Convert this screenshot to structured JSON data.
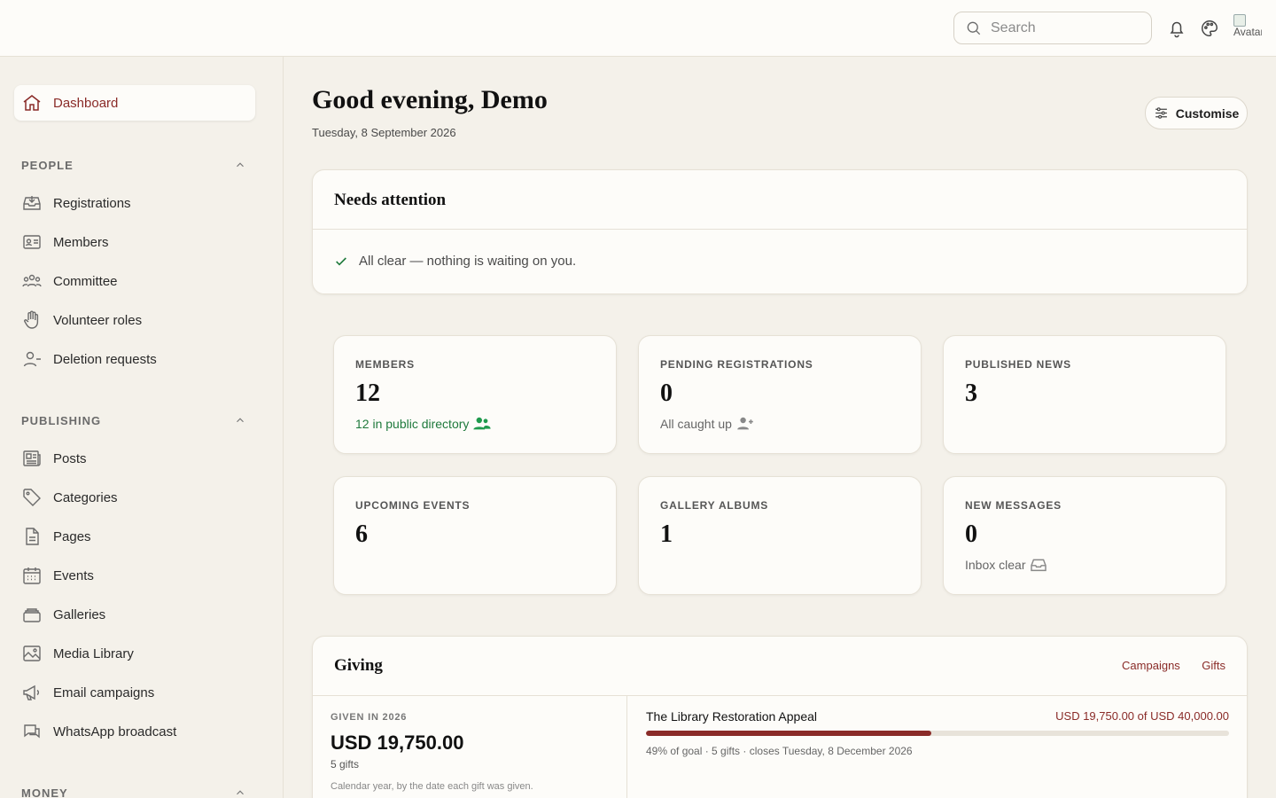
{
  "search": {
    "placeholder": "Search"
  },
  "user": {
    "avatar_alt": "Avatar"
  },
  "sidebar": {
    "active": {
      "label": "Dashboard"
    },
    "sections": [
      {
        "title": "PEOPLE",
        "items": [
          {
            "label": "Registrations",
            "icon": "inbox-download-icon"
          },
          {
            "label": "Members",
            "icon": "id-card-icon"
          },
          {
            "label": "Committee",
            "icon": "group-icon"
          },
          {
            "label": "Volunteer roles",
            "icon": "hand-icon"
          },
          {
            "label": "Deletion requests",
            "icon": "user-minus-icon"
          }
        ]
      },
      {
        "title": "PUBLISHING",
        "items": [
          {
            "label": "Posts",
            "icon": "newspaper-icon"
          },
          {
            "label": "Categories",
            "icon": "tag-icon"
          },
          {
            "label": "Pages",
            "icon": "document-icon"
          },
          {
            "label": "Events",
            "icon": "calendar-icon"
          },
          {
            "label": "Galleries",
            "icon": "stack-icon"
          },
          {
            "label": "Media Library",
            "icon": "image-icon"
          },
          {
            "label": "Email campaigns",
            "icon": "megaphone-icon"
          },
          {
            "label": "WhatsApp broadcast",
            "icon": "chat-icon"
          }
        ]
      },
      {
        "title": "MONEY",
        "items": []
      }
    ]
  },
  "main": {
    "greeting": "Good evening, Demo",
    "date": "Tuesday, 8 September 2026",
    "customise_label": "Customise",
    "attention": {
      "title": "Needs attention",
      "message": "All clear — nothing is waiting on you."
    },
    "stats": [
      {
        "title": "MEMBERS",
        "value": "12",
        "sub": "12 in public directory",
        "sub_color": "#1f7a3d"
      },
      {
        "title": "PENDING REGISTRATIONS",
        "value": "0",
        "sub": "All caught up"
      },
      {
        "title": "PUBLISHED NEWS",
        "value": "3",
        "sub": ""
      },
      {
        "title": "UPCOMING EVENTS",
        "value": "6",
        "sub": ""
      },
      {
        "title": "GALLERY ALBUMS",
        "value": "1",
        "sub": ""
      },
      {
        "title": "NEW MESSAGES",
        "value": "0",
        "sub": "Inbox clear"
      }
    ],
    "giving": {
      "title": "Giving",
      "links": [
        "Campaigns",
        "Gifts"
      ],
      "summary_title": "GIVEN IN 2026",
      "summary_value": "USD 19,750.00",
      "summary_count": "5 gifts",
      "summary_note": "Calendar year, by the date each gift was given.",
      "campaign": {
        "name": "The Library Restoration Appeal",
        "amount": "USD 19,750.00 of USD 40,000.00",
        "progress": 0.49,
        "meta": "49% of goal · 5 gifts · closes Tuesday, 8 December 2026"
      }
    }
  },
  "colors": {
    "accent": "#8a2b28",
    "success": "#1f7a3d",
    "background": "#f4f1ea",
    "surface": "#fdfcf9"
  }
}
